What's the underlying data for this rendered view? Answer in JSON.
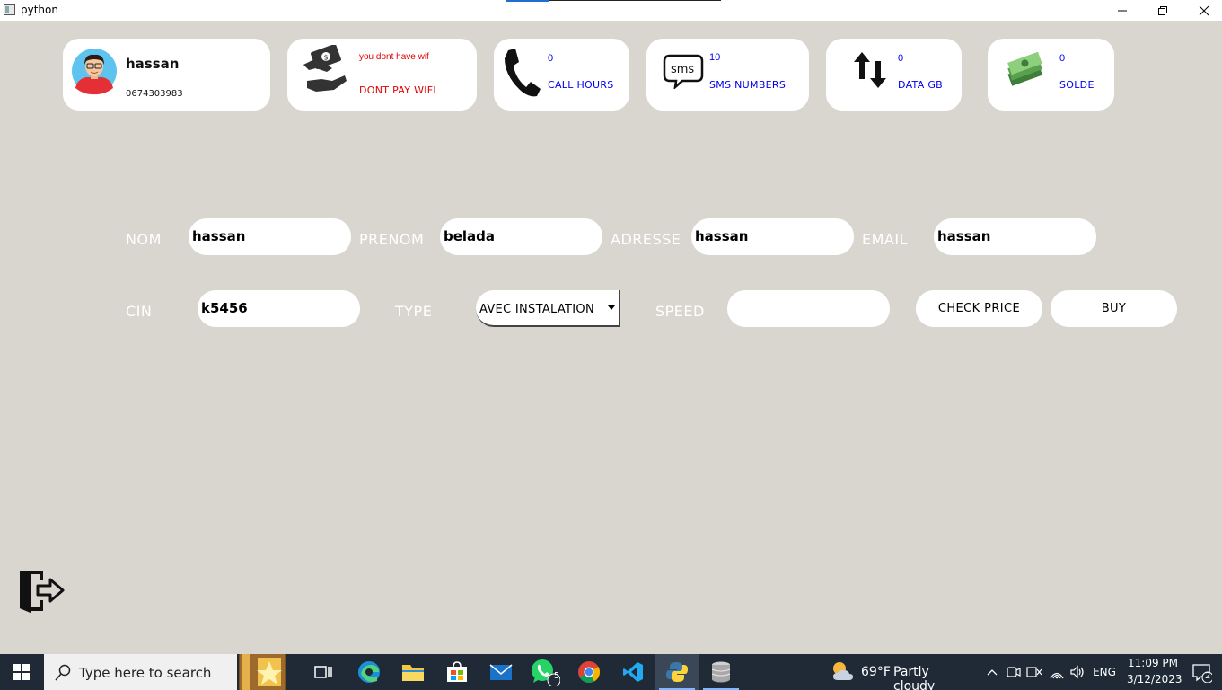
{
  "window": {
    "title": "python"
  },
  "profile": {
    "name": "hassan",
    "phone": "0674303983"
  },
  "wifi": {
    "message": "you dont have wif",
    "status": "DONT PAY WIFI",
    "color": "#e00000"
  },
  "stats": {
    "call": {
      "value": "0",
      "label": "CALL HOURS"
    },
    "sms": {
      "value": "10",
      "label": "SMS NUMBERS",
      "icon_text": "sms"
    },
    "data": {
      "value": "0",
      "label": "DATA GB"
    },
    "solde": {
      "value": "0",
      "label": "SOLDE"
    }
  },
  "form": {
    "nom": {
      "label": "NOM",
      "value": "hassan"
    },
    "prenom": {
      "label": "PRENOM",
      "value": "belada"
    },
    "adresse": {
      "label": "ADRESSE",
      "value": "hassan"
    },
    "email": {
      "label": "EMAIL",
      "value": "hassan"
    },
    "cin": {
      "label": "CIN",
      "value": "k5456"
    },
    "type": {
      "label": "TYPE",
      "selected": "AVEC INSTALATION"
    },
    "speed": {
      "label": "SPEED",
      "value": ""
    },
    "check_price_label": "CHECK PRICE",
    "buy_label": "BUY"
  },
  "taskbar": {
    "search_placeholder": "Type here to search",
    "whatsapp_badge": "5",
    "weather_temp": "69°F",
    "weather_text": "Partly cloudy",
    "language": "ENG",
    "time": "11:09 PM",
    "date": "3/12/2023",
    "notifications": "2"
  },
  "colors": {
    "background": "#d9d6d0",
    "accent_text": "#0000ee",
    "taskbar": "#1f2a36"
  }
}
